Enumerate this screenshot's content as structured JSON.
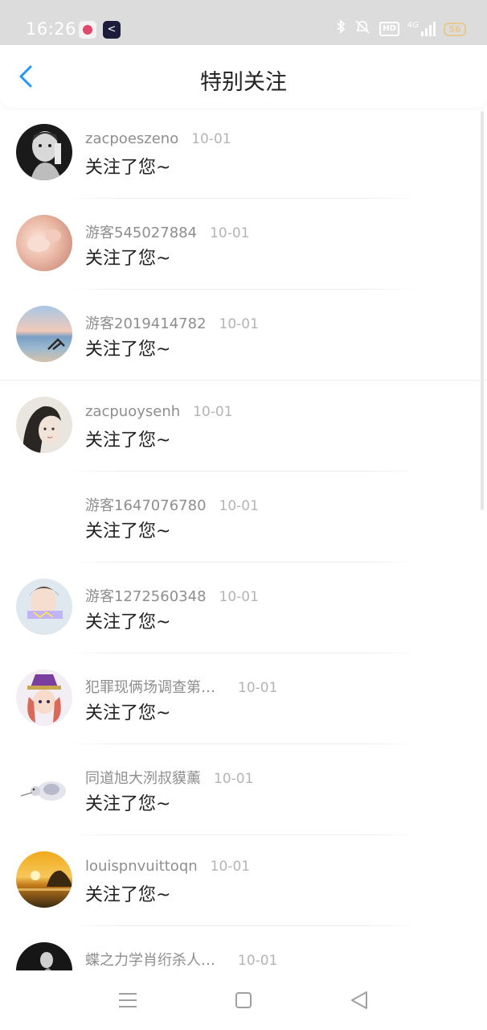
{
  "status_bar": {
    "time": "16:26",
    "app_icon_2_glyph": "<",
    "hd_label": "HD",
    "network_label": "4G",
    "battery": "56"
  },
  "header": {
    "title": "特别关注"
  },
  "items": [
    {
      "name": "zacpoeszeno",
      "date": "10-01",
      "message": "关注了您~",
      "avatar_icon": "avatar-bw-portrait"
    },
    {
      "name": "游客545027884",
      "date": "10-01",
      "message": "关注了您~",
      "avatar_icon": "avatar-pink-blur"
    },
    {
      "name": "游客2019414782",
      "date": "10-01",
      "message": "关注了您~",
      "avatar_icon": "avatar-beach-chair"
    },
    {
      "name": "zacpuoysenh",
      "date": "10-01",
      "message": "关注了您~",
      "avatar_icon": "avatar-woman-face"
    },
    {
      "name": "游客1647076780",
      "date": "10-01",
      "message": "关注了您~",
      "avatar_icon": "avatar-empty"
    },
    {
      "name": "游客1272560348",
      "date": "10-01",
      "message": "关注了您~",
      "avatar_icon": "avatar-selfie"
    },
    {
      "name": "犯罪现俩场调查第…",
      "date": "10-01",
      "message": "关注了您~",
      "avatar_icon": "avatar-cartoon-hat"
    },
    {
      "name": "同道旭大洌叔貘薰",
      "date": "10-01",
      "message": "关注了您~",
      "avatar_icon": "avatar-bird"
    },
    {
      "name": "louispnvuittoqn",
      "date": "10-01",
      "message": "关注了您~",
      "avatar_icon": "avatar-sunset-sea"
    },
    {
      "name": "蝶之力学肖绗杀人…",
      "date": "10-01",
      "message": "",
      "avatar_icon": "avatar-dark-figure"
    }
  ],
  "colors": {
    "accent": "#2196f3",
    "status_bar_bg": "#dcdcdc",
    "name_text": "#8e8e8e",
    "date_text": "#b4b4b4",
    "message_text": "#222222"
  },
  "nav_icons": [
    "menu-icon",
    "home-square-icon",
    "back-triangle-icon"
  ]
}
